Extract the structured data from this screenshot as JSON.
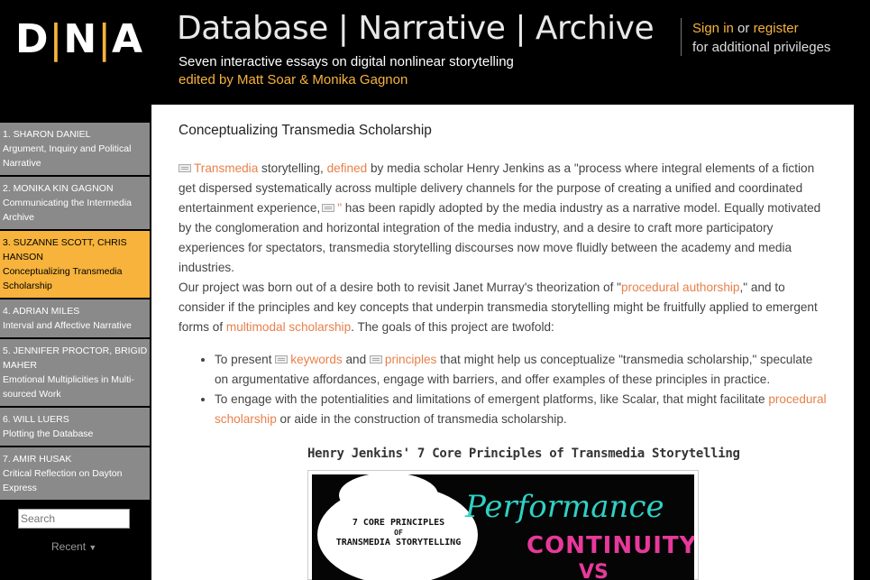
{
  "header": {
    "logo": {
      "d": "D",
      "n": "N",
      "a": "A",
      "sep": "|"
    },
    "title": "Database | Narrative | Archive",
    "subtitle": "Seven interactive essays on digital nonlinear storytelling",
    "editors": "edited by Matt Soar & Monika Gagnon",
    "sign_in": "Sign in",
    "or": "or",
    "register": "register",
    "privileges": "for additional privileges"
  },
  "sidebar": {
    "chapters": [
      {
        "author": "1. SHARON DANIEL",
        "title": "Argument, Inquiry and Political Narrative",
        "active": false
      },
      {
        "author": "2. MONIKA KIN GAGNON",
        "title": "Communicating the Intermedia Archive",
        "active": false
      },
      {
        "author": "3. SUZANNE SCOTT, CHRIS HANSON",
        "title": "Conceptualizing Transmedia Scholarship",
        "active": true
      },
      {
        "author": "4. ADRIAN MILES",
        "title": "Interval and Affective Narrative",
        "active": false
      },
      {
        "author": "5. JENNIFER PROCTOR, BRIGID MAHER",
        "title": "Emotional Multiplicities in Multi-sourced Work",
        "active": false
      },
      {
        "author": "6. WILL LUERS",
        "title": "Plotting the Database",
        "active": false
      },
      {
        "author": "7. AMIR HUSAK",
        "title": "Critical Reflection on Dayton Express",
        "active": false
      }
    ],
    "search_placeholder": "Search",
    "recent": "Recent"
  },
  "main": {
    "page_title": "Conceptualizing Transmedia Scholarship",
    "p1": {
      "link_transmedia": "Transmedia",
      "t1": " storytelling, ",
      "link_defined": "defined",
      "t2": " by media scholar Henry Jenkins as a \"process where integral elements of a fiction get dispersed systematically across multiple delivery channels for the purpose of creating a unified and coordinated entertainment experience,",
      "link_quote": "\"",
      "t3": " has been rapidly adopted by the media industry as a narrative model. Equally motivated by the conglomeration and horizontal integration of the media industry, and a desire to craft more participatory experiences for spectators, transmedia storytelling discourses now move fluidly between the academy and media industries."
    },
    "p2": {
      "t1": "Our project was born out of a desire both to revisit Janet Murray's theorization of \"",
      "link_procedural": "procedural authorship",
      "t2": ",\" and to consider if the principles and key concepts that underpin transmedia storytelling might be fruitfully applied to emergent forms of ",
      "link_multimodal": "multimodal scholarship",
      "t3": ". The goals of this project are twofold:"
    },
    "bullets": {
      "b1_t1": "To present ",
      "b1_link_keywords": "keywords",
      "b1_t2": " and ",
      "b1_link_principles": "principles",
      "b1_t3": " that might help us conceptualize \"transmedia scholarship,\" speculate on argumentative affordances, engage with barriers, and offer examples of these principles in practice.",
      "b2_t1": "To engage with the potentialities and limitations of emergent platforms, like Scalar, that might facilitate ",
      "b2_link": "procedural scholarship",
      "b2_t2": " or aide in the construction of transmedia scholarship."
    },
    "figure": {
      "caption": "Henry Jenkins' 7 Core Principles of Transmedia Storytelling",
      "cloud_line1": "7 CORE PRINCIPLES",
      "cloud_line2": "OF",
      "cloud_line3": "TRANSMEDIA STORYTELLING",
      "word_performance": "Performance",
      "word_continuity": "CONTINUITY",
      "word_vs": "VS"
    }
  },
  "colors": {
    "accent": "#f7b33b",
    "link": "#e8804a",
    "sidebar_item": "#8a8a8a",
    "header_bg": "#000000"
  }
}
